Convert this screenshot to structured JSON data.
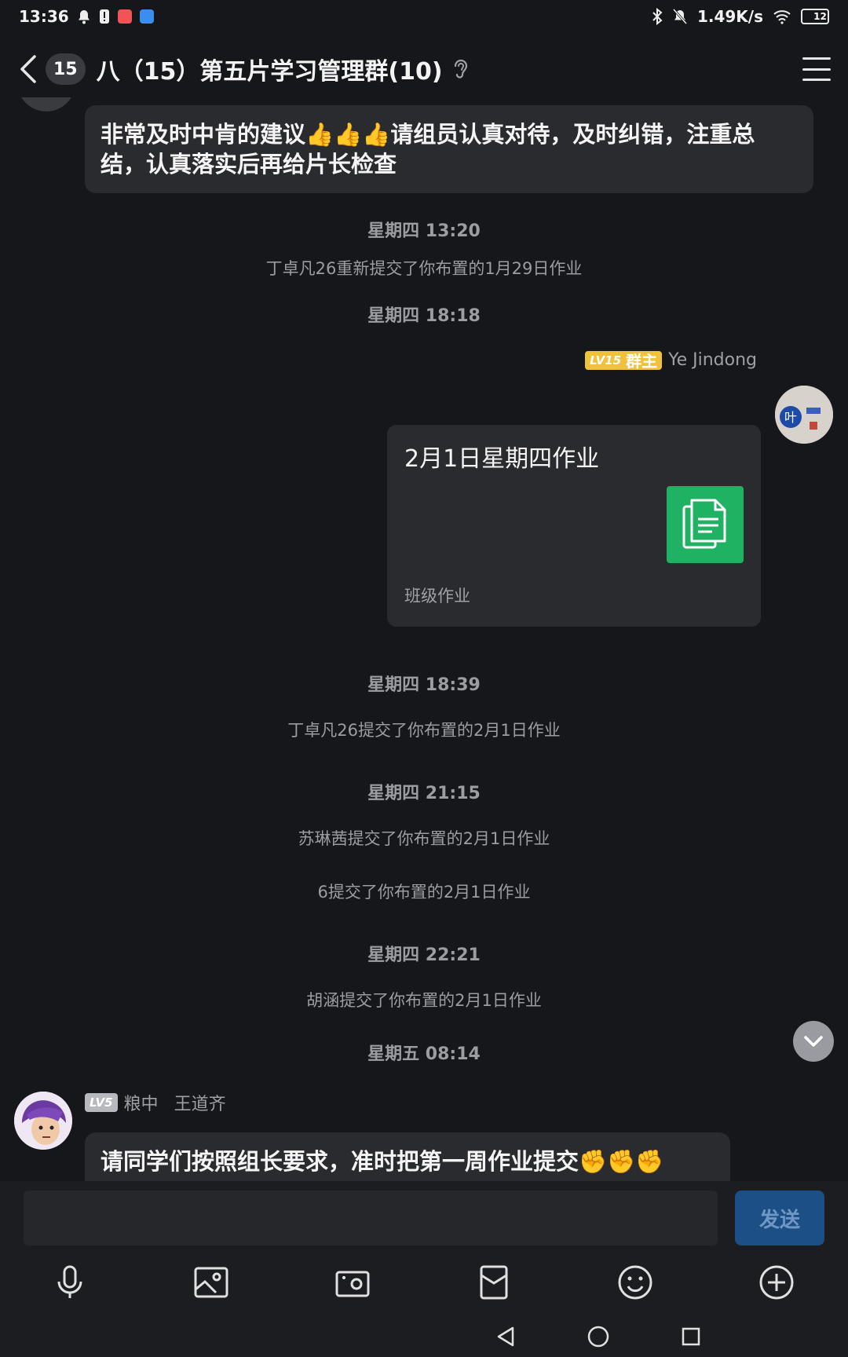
{
  "status_bar": {
    "time": "13:36",
    "network_speed": "1.49K/s",
    "battery": "12",
    "colors": {
      "app1": "#f05454",
      "app2": "#3a8ef0",
      "battery_fill": "#f0c23b"
    }
  },
  "header": {
    "unread_count": "15",
    "title": "八（15）第五片学习管理群(10)"
  },
  "messages": {
    "m1": {
      "text": "非常及时中肯的建议👍👍👍请组员认真对待，及时纠错，注重总结，认真落实后再给片长检查"
    },
    "t1": "星期四 13:20",
    "n1": "丁卓凡26重新提交了你布置的1月29日作业",
    "t2": "星期四 18:18",
    "owner": {
      "level": "LV15",
      "role": "群主",
      "name": "Ye Jindong",
      "avatar_text": "叶"
    },
    "file_card": {
      "title": "2月1日星期四作业",
      "source": "班级作业",
      "icon": "document-icon",
      "icon_color": "#1fb262"
    },
    "t3": "星期四 18:39",
    "n2": "丁卓凡26提交了你布置的2月1日作业",
    "t4": "星期四 21:15",
    "n3": "苏琳茜提交了你布置的2月1日作业",
    "n4": "6提交了你布置的2月1日作业",
    "t5": "星期四 22:21",
    "n5": "胡涵提交了你布置的2月1日作业",
    "t6": "星期五 08:14",
    "member": {
      "level": "LV5",
      "title": "粮中",
      "name": "王道齐"
    },
    "m2": {
      "text": "请同学们按照组长要求，准时把第一周作业提交✊✊✊"
    }
  },
  "input": {
    "placeholder": "",
    "send_label": "发送"
  },
  "toolbar": [
    "microphone-icon",
    "image-icon",
    "camera-icon",
    "red-packet-icon",
    "emoji-icon",
    "plus-icon"
  ],
  "nav": [
    "back-triangle-icon",
    "home-circle-icon",
    "recent-square-icon"
  ]
}
